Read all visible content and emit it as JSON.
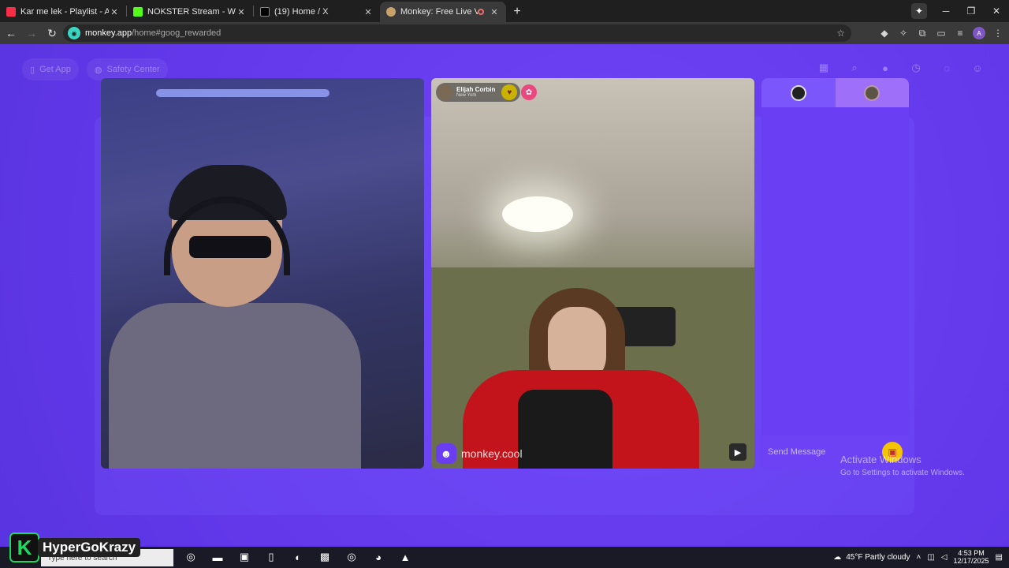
{
  "browser": {
    "tabs": [
      {
        "title": "Kar me lek - Playlist - Apple M",
        "favicon_color": "#fa2d48"
      },
      {
        "title": "NOKSTER Stream - Watch Live",
        "favicon_color": "#53fc18"
      },
      {
        "title": "(19) Home / X",
        "favicon_color": "#000000"
      },
      {
        "title": "Monkey: Free Live Video Ch",
        "favicon_color": "#c8a26a"
      }
    ],
    "url_host": "monkey.app",
    "url_path": "/home#goog_rewarded"
  },
  "app": {
    "nav_left": [
      {
        "label": "Get App",
        "icon": "phone-icon"
      },
      {
        "label": "Safety Center",
        "icon": "shield-icon"
      }
    ],
    "nav_right_icons": [
      "shop-icon",
      "search-icon",
      "coin-icon",
      "history-icon",
      "chat-icon",
      "profile-icon"
    ],
    "remote_user": {
      "name": "Elijah Corbin",
      "location": "New York"
    },
    "watermark": "monkey.cool",
    "chat": {
      "placeholder": "Send Message"
    }
  },
  "os": {
    "activate_title": "Activate Windows",
    "activate_sub": "Go to Settings to activate Windows.",
    "search_placeholder": "Type here to search",
    "weather": "45°F  Partly cloudy",
    "time": "4:53 PM",
    "date": "12/17/2025"
  },
  "overlay": {
    "streamer_name": "HyperGoKrazy"
  },
  "colors": {
    "page_bg": "#6a3df0",
    "accent_gold": "#f4c400",
    "gift_pink": "#e84a7f"
  }
}
